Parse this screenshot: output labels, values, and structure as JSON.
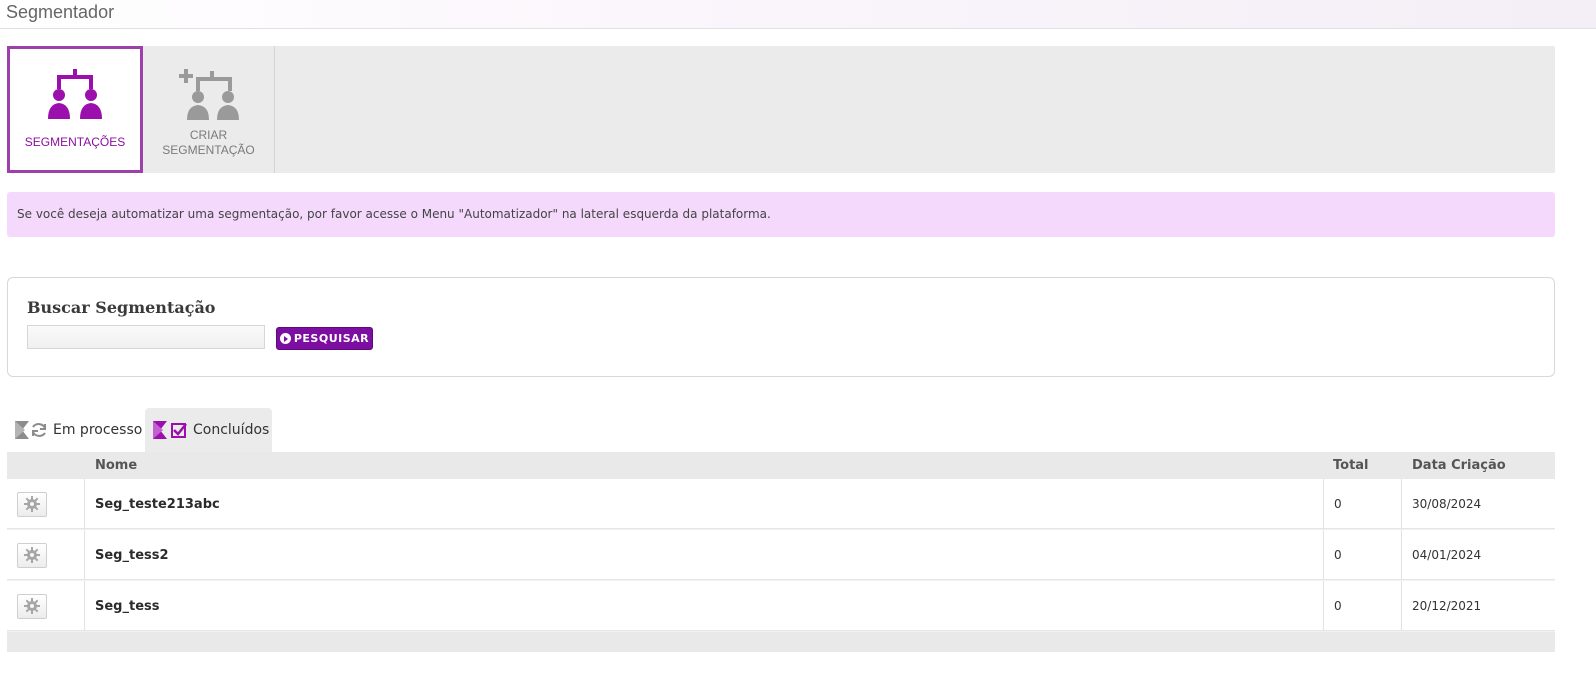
{
  "page": {
    "title": "Segmentador"
  },
  "toolbar": {
    "items": [
      {
        "label": "SEGMENTAÇÕES",
        "icon": "segment-group-icon",
        "active": true
      },
      {
        "label_line1": "CRIAR",
        "label_line2": "SEGMENTAÇÃO",
        "icon": "create-segment-icon",
        "active": false
      }
    ]
  },
  "notice": {
    "text": "Se você deseja automatizar uma segmentação, por favor acesse o Menu \"Automatizador\" na lateral esquerda da plataforma."
  },
  "search": {
    "title": "Buscar Segmentação",
    "input_value": "",
    "button_label": "PESQUISAR"
  },
  "tabs": [
    {
      "label": "Em processo",
      "icon": "processing-icon",
      "active": false
    },
    {
      "label": "Concluídos",
      "icon": "completed-icon",
      "active": true
    }
  ],
  "table": {
    "headers": {
      "name": "Nome",
      "total": "Total",
      "date": "Data Criação"
    },
    "rows": [
      {
        "name": "Seg_teste213abc",
        "total": "0",
        "date": "30/08/2024"
      },
      {
        "name": "Seg_tess2",
        "total": "0",
        "date": "04/01/2024"
      },
      {
        "name": "Seg_tess",
        "total": "0",
        "date": "20/12/2021"
      }
    ]
  },
  "colors": {
    "accent": "#8a0fa0",
    "notice_bg": "#f4d9fc",
    "button": "#7d0ea2"
  }
}
